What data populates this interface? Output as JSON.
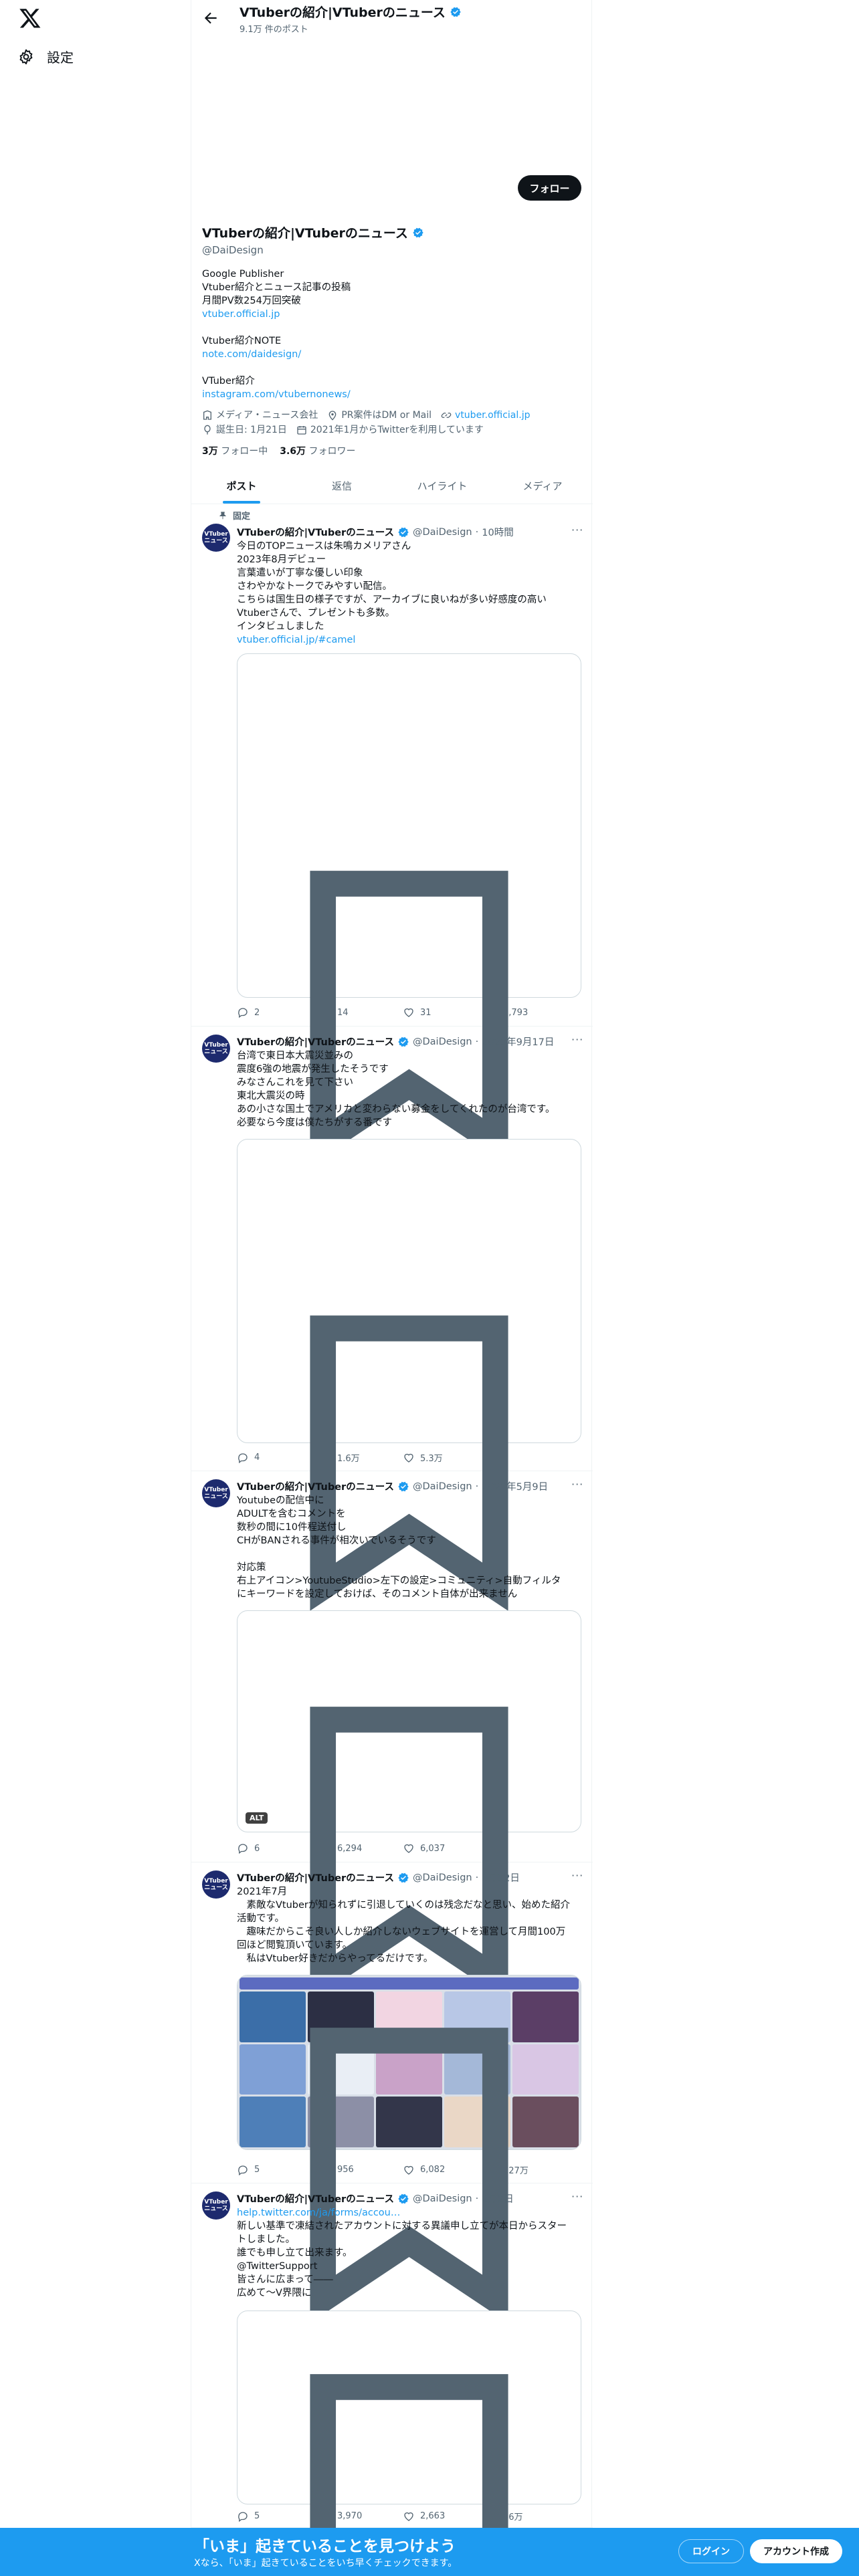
{
  "nav": {
    "settings_label": "設定",
    "logo_icon": "x-logo-icon"
  },
  "header": {
    "title": "VTuberの紹介|VTuberのニュース",
    "post_count": "9.1万 件のポスト"
  },
  "profile": {
    "follow_label": "フォロー",
    "name": "VTuberの紹介|VTuberのニュース",
    "handle": "@DaiDesign",
    "bio": [
      "Google Publisher",
      "Vtuber紹介とニュース記事の投稿",
      "月間PV数254万回突破",
      "vtuber.official.jp",
      "",
      "Vtuber紹介NOTE",
      "note.com/daidesign/",
      "",
      "VTuber紹介",
      "instagram.com/vtubernonews/"
    ],
    "category": "メディア・ニュース会社",
    "location": "PR案件はDM or Mail",
    "website": "vtuber.official.jp",
    "birthday": "誕生日: 1月21日",
    "joined": "2021年1月からTwitterを利用しています",
    "following_count": "3万",
    "following_label": "フォロー中",
    "followers_count": "3.6万",
    "followers_label": "フォロワー"
  },
  "tabs": [
    "ポスト",
    "返信",
    "ハイライト",
    "メディア"
  ],
  "tweets": [
    {
      "pinned_label": "固定",
      "name": "VTuberの紹介|VTuberのニュース",
      "handle": "@DaiDesign",
      "time": "10時間",
      "lines": [
        "今日のTOPニュースは朱鳴カメリアさん",
        "2023年8月デビュー",
        "言葉遣いが丁寧な優しい印象",
        "さわやかなトークでみやすい配信。",
        "こちらは国生日の様子ですが、アーカイブに良いねが多い好感度の高い",
        "Vtuberさんで、プレゼントも多数。",
        "インタビュしました",
        "vtuber.official.jp/#camel"
      ],
      "replies": "2",
      "reposts": "14",
      "likes": "31",
      "views": "5,793"
    },
    {
      "name": "VTuberの紹介|VTuberのニュース",
      "handle": "@DaiDesign",
      "time": "2022年9月17日",
      "lines": [
        "台湾で東日本大震災並みの",
        "震度6強の地震が発生したそうです",
        "みなさんこれを見て下さい",
        "東北大震災の時",
        "あの小さな国土でアメリカと変わらない募金をしてくれたのが台湾です。",
        "必要なら今度は僕たちがする番です"
      ],
      "replies": "4",
      "reposts": "1.6万",
      "likes": "5.3万",
      "views": ""
    },
    {
      "name": "VTuberの紹介|VTuberのニュース",
      "handle": "@DaiDesign",
      "time": "2022年5月9日",
      "lines": [
        "Youtubeの配信中に",
        "ADULTを含むコメントを",
        "数秒の間に10件程送付し",
        "CHがBANされる事件が相次いでいるそうです",
        "",
        "対応策",
        "右上アイコン>YoutubeStudio>左下の設定>コミュニティ>自動フィルタ",
        "にキーワードを設定しておけば、そのコメント自体が出来ません"
      ],
      "alt_label": "ALT",
      "replies": "6",
      "reposts": "6,294",
      "likes": "6,037",
      "views": ""
    },
    {
      "name": "VTuberの紹介|VTuberのニュース",
      "handle": "@DaiDesign",
      "time": "3月12日",
      "lines": [
        "2021年7月",
        "　素敵なVtuberが知られずに引退していくのは残念だなと思い、始めた紹介",
        "活動です。",
        "　趣味だからこそ良い人しか紹介しないウェブサイトを運営して月間100万",
        "回ほど閲覧頂いています。",
        "　私はVtuber好きだからやってるだけです。"
      ],
      "replies": "5",
      "reposts": "956",
      "likes": "6,082",
      "views": "127万"
    },
    {
      "name": "VTuberの紹介|VTuberのニュース",
      "handle": "@DaiDesign",
      "time": "2月2日",
      "lines": [
        "help.twitter.com/ja/forms/accou…",
        "新しい基準で凍結されたアカウントに対する異議申し立てが本日からスター",
        "トしました。",
        "誰でも申し立て出来ます。",
        "@TwitterSupport",
        "皆さんに広まって――",
        "広めて～V界隈に"
      ],
      "replies": "5",
      "reposts": "3,970",
      "likes": "2,663",
      "views": "46万"
    }
  ],
  "banner": {
    "title": "「いま」起きていることを見つけよう",
    "subtitle": "Xなら、「いま」起きていることをいち早くチェックできます。",
    "login_label": "ログイン",
    "signup_label": "アカウント作成"
  },
  "colors": {
    "accent": "#1d9bf0",
    "text": "#0f1419",
    "muted": "#536471",
    "border": "#eff3f4"
  }
}
